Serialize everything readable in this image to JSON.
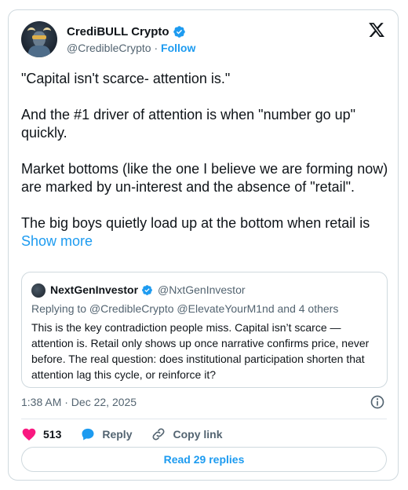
{
  "author": {
    "name": "CrediBULL Crypto",
    "handle": "@CredibleCrypto",
    "separator": "·",
    "follow_label": "Follow"
  },
  "tweet": {
    "paragraphs": [
      "\"Capital isn't scarce- attention is.\"",
      "And the #1 driver of attention is when \"number go up\" quickly.",
      "Market bottoms (like the one I believe we are forming now) are marked by un-interest and the absence of \"retail\".",
      "The big boys quietly load up at the bottom when retail is"
    ],
    "show_more_label": "Show more",
    "timestamp": "1:38 AM · Dec 22, 2025"
  },
  "quote": {
    "name": "NextGenInvestor",
    "handle": "@NxtGenInvestor",
    "replying_to": "Replying to @CredibleCrypto @ElevateYourM1nd and 4 others",
    "body": "This is the key contradiction people miss. Capital isn’t scarce — attention is. Retail only shows up once narrative confirms price, never before. The real question: does institutional participation shorten that attention lag this cycle, or reinforce it?"
  },
  "actions": {
    "likes": "513",
    "reply_label": "Reply",
    "copy_link_label": "Copy link"
  },
  "read_replies_label": "Read 29 replies",
  "colors": {
    "accent": "#1d9bf0",
    "like": "#f91880",
    "text": "#0f1419",
    "muted": "#536471",
    "border": "#cfd9de"
  },
  "icons": [
    "verified-badge-icon",
    "x-logo-icon",
    "info-icon",
    "heart-icon",
    "reply-bubble-icon",
    "link-icon"
  ]
}
